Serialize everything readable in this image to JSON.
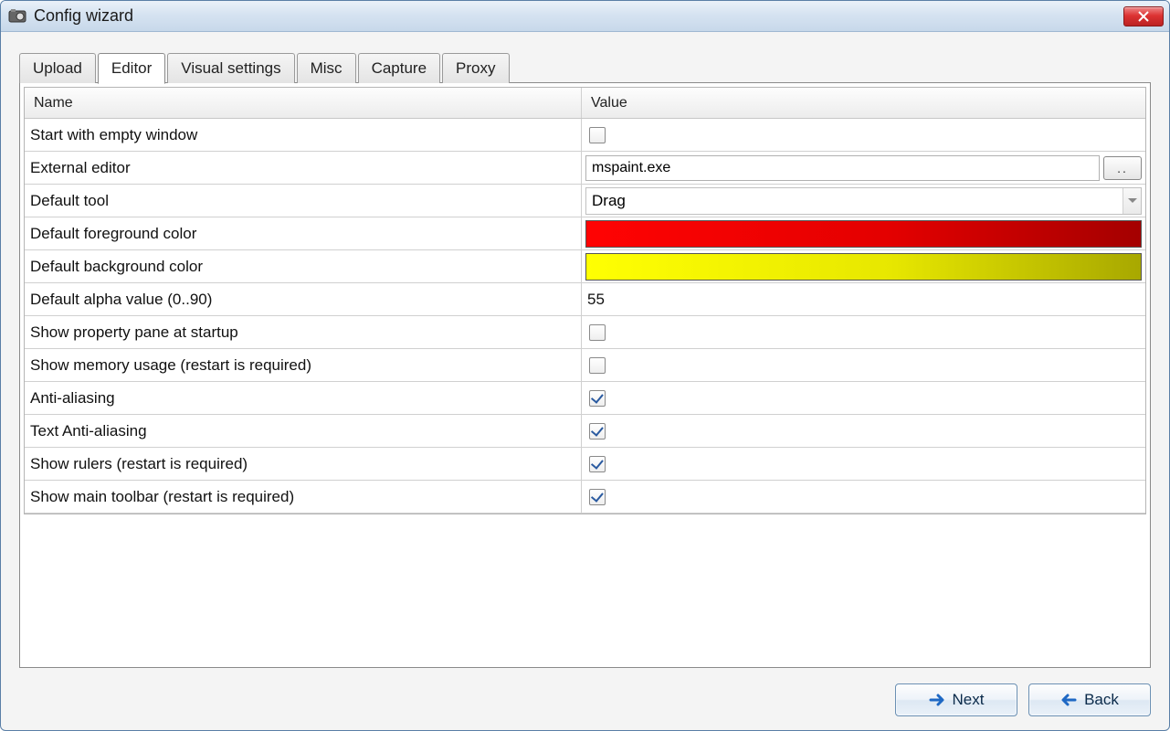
{
  "window": {
    "title": "Config wizard"
  },
  "tabs": [
    {
      "label": "Upload",
      "active": false
    },
    {
      "label": "Editor",
      "active": true
    },
    {
      "label": "Visual settings",
      "active": false
    },
    {
      "label": "Misc",
      "active": false
    },
    {
      "label": "Capture",
      "active": false
    },
    {
      "label": "Proxy",
      "active": false
    }
  ],
  "grid": {
    "header": {
      "name": "Name",
      "value": "Value"
    },
    "rows": [
      {
        "name": "Start with empty window",
        "type": "checkbox",
        "checked": false
      },
      {
        "name": "External editor",
        "type": "text_browse",
        "value": "mspaint.exe",
        "browse_label": ".."
      },
      {
        "name": "Default tool",
        "type": "combo",
        "value": "Drag"
      },
      {
        "name": "Default foreground color",
        "type": "color",
        "color_class": "grad-red",
        "color_value": "#ff0000"
      },
      {
        "name": "Default background color",
        "type": "color",
        "color_class": "grad-yellow",
        "color_value": "#ffff00"
      },
      {
        "name": "Default alpha value (0..90)",
        "type": "text",
        "value": "55"
      },
      {
        "name": "Show property pane at startup",
        "type": "checkbox",
        "checked": false
      },
      {
        "name": "Show memory usage (restart is required)",
        "type": "checkbox",
        "checked": false
      },
      {
        "name": "Anti-aliasing",
        "type": "checkbox",
        "checked": true
      },
      {
        "name": "Text Anti-aliasing",
        "type": "checkbox",
        "checked": true
      },
      {
        "name": "Show rulers (restart is required)",
        "type": "checkbox",
        "checked": true
      },
      {
        "name": "Show main toolbar (restart is required)",
        "type": "checkbox",
        "checked": true
      }
    ]
  },
  "footer": {
    "next_label": "Next",
    "back_label": "Back"
  }
}
